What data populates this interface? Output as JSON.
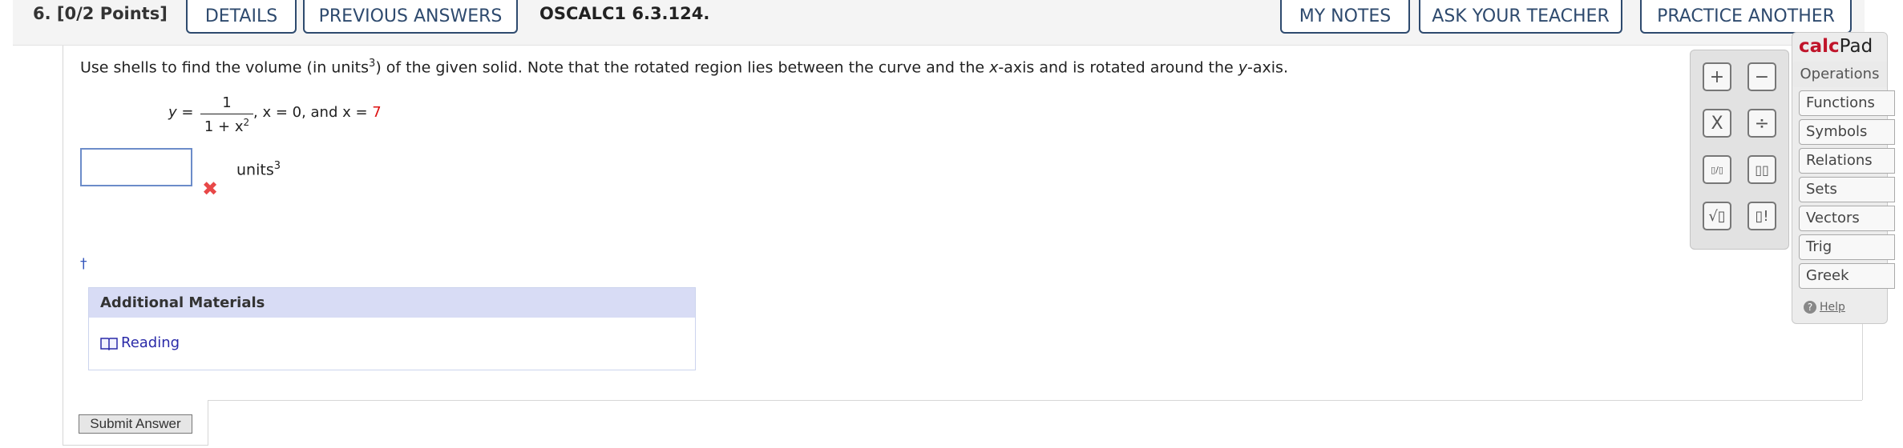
{
  "header": {
    "question_number": "6.",
    "points": "[0/2 Points]",
    "details_label": "DETAILS",
    "previous_answers_label": "PREVIOUS ANSWERS",
    "question_id": "OSCALC1 6.3.124.",
    "my_notes_label": "MY NOTES",
    "ask_teacher_label": "ASK YOUR TEACHER",
    "practice_another_label": "PRACTICE ANOTHER"
  },
  "question": {
    "prompt_part1": "Use shells to find the volume (in units",
    "prompt_exp": "3",
    "prompt_part2": ") of the given solid. Note that the rotated region lies between the curve and the ",
    "prompt_var_x": "x",
    "prompt_part3": "-axis and is rotated around the ",
    "prompt_var_y": "y",
    "prompt_part4": "-axis.",
    "eq_lhs": "y =",
    "eq_numerator": "1",
    "eq_denominator": "1 + x",
    "eq_den_exp": "2",
    "eq_rest": ", x = 0, and x = ",
    "eq_limit": "7",
    "answer_value": "",
    "units_label": "units",
    "units_exp": "3",
    "incorrect_mark": "✖",
    "dagger": "†"
  },
  "additional_materials": {
    "title": "Additional Materials",
    "reading_label": "Reading"
  },
  "submit_label": "Submit Answer",
  "calcpad": {
    "title_calc": "calc",
    "title_pad": "Pad",
    "buttons": [
      "+",
      "−",
      "X",
      "÷",
      "▯/▯",
      "▯▯",
      "√▯",
      "▯!"
    ],
    "tabs": [
      "Operations",
      "Functions",
      "Symbols",
      "Relations",
      "Sets",
      "Vectors",
      "Trig",
      "Greek"
    ],
    "help_label": "Help"
  }
}
